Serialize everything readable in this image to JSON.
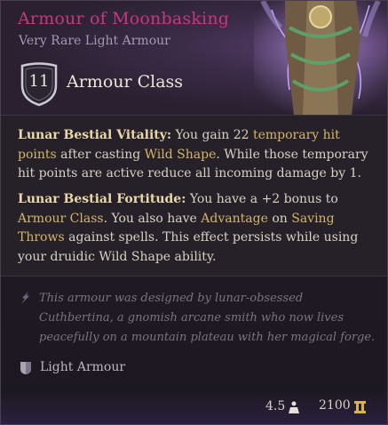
{
  "item": {
    "name": "Armour of Moonbasking",
    "subtitle": "Very Rare Light Armour",
    "armour_class_value": "11",
    "armour_class_label": "Armour Class"
  },
  "effects": [
    {
      "name": "Lunar Bestial Vitality:",
      "t1": " You gain 22 ",
      "k1": "temporary hit points",
      "t2": " after casting ",
      "k2": "Wild Shape",
      "t3": ". While those temporary hit points are active reduce all incoming damage by 1."
    },
    {
      "name": "Lunar Bestial Fortitude:",
      "t1": " You have a +2 bonus to ",
      "k1": "Armour Class",
      "t2": ". You also have ",
      "k2": "Advantage",
      "t3": " on ",
      "k3": "Saving Throws",
      "t4": " against spells. This effect persists while using your druidic Wild Shape ability."
    }
  ],
  "lore": "This armour was designed by lunar-obsessed Cuthbertina, a gnomish arcane smith who now lives peacefully on a mountain plateau with her magical forge.",
  "type_label": "Light Armour",
  "footer": {
    "weight": "4.5",
    "price": "2100"
  },
  "icons": {
    "armour_class": "shield-icon",
    "lore": "quill-icon",
    "type": "armour-icon",
    "weight": "weight-icon",
    "gold": "gold-coin-icon"
  },
  "colors": {
    "title": "#c8367e",
    "keyword": "#d4b56a",
    "effect_name": "#e9d9a8",
    "lore": "#7b7480"
  }
}
